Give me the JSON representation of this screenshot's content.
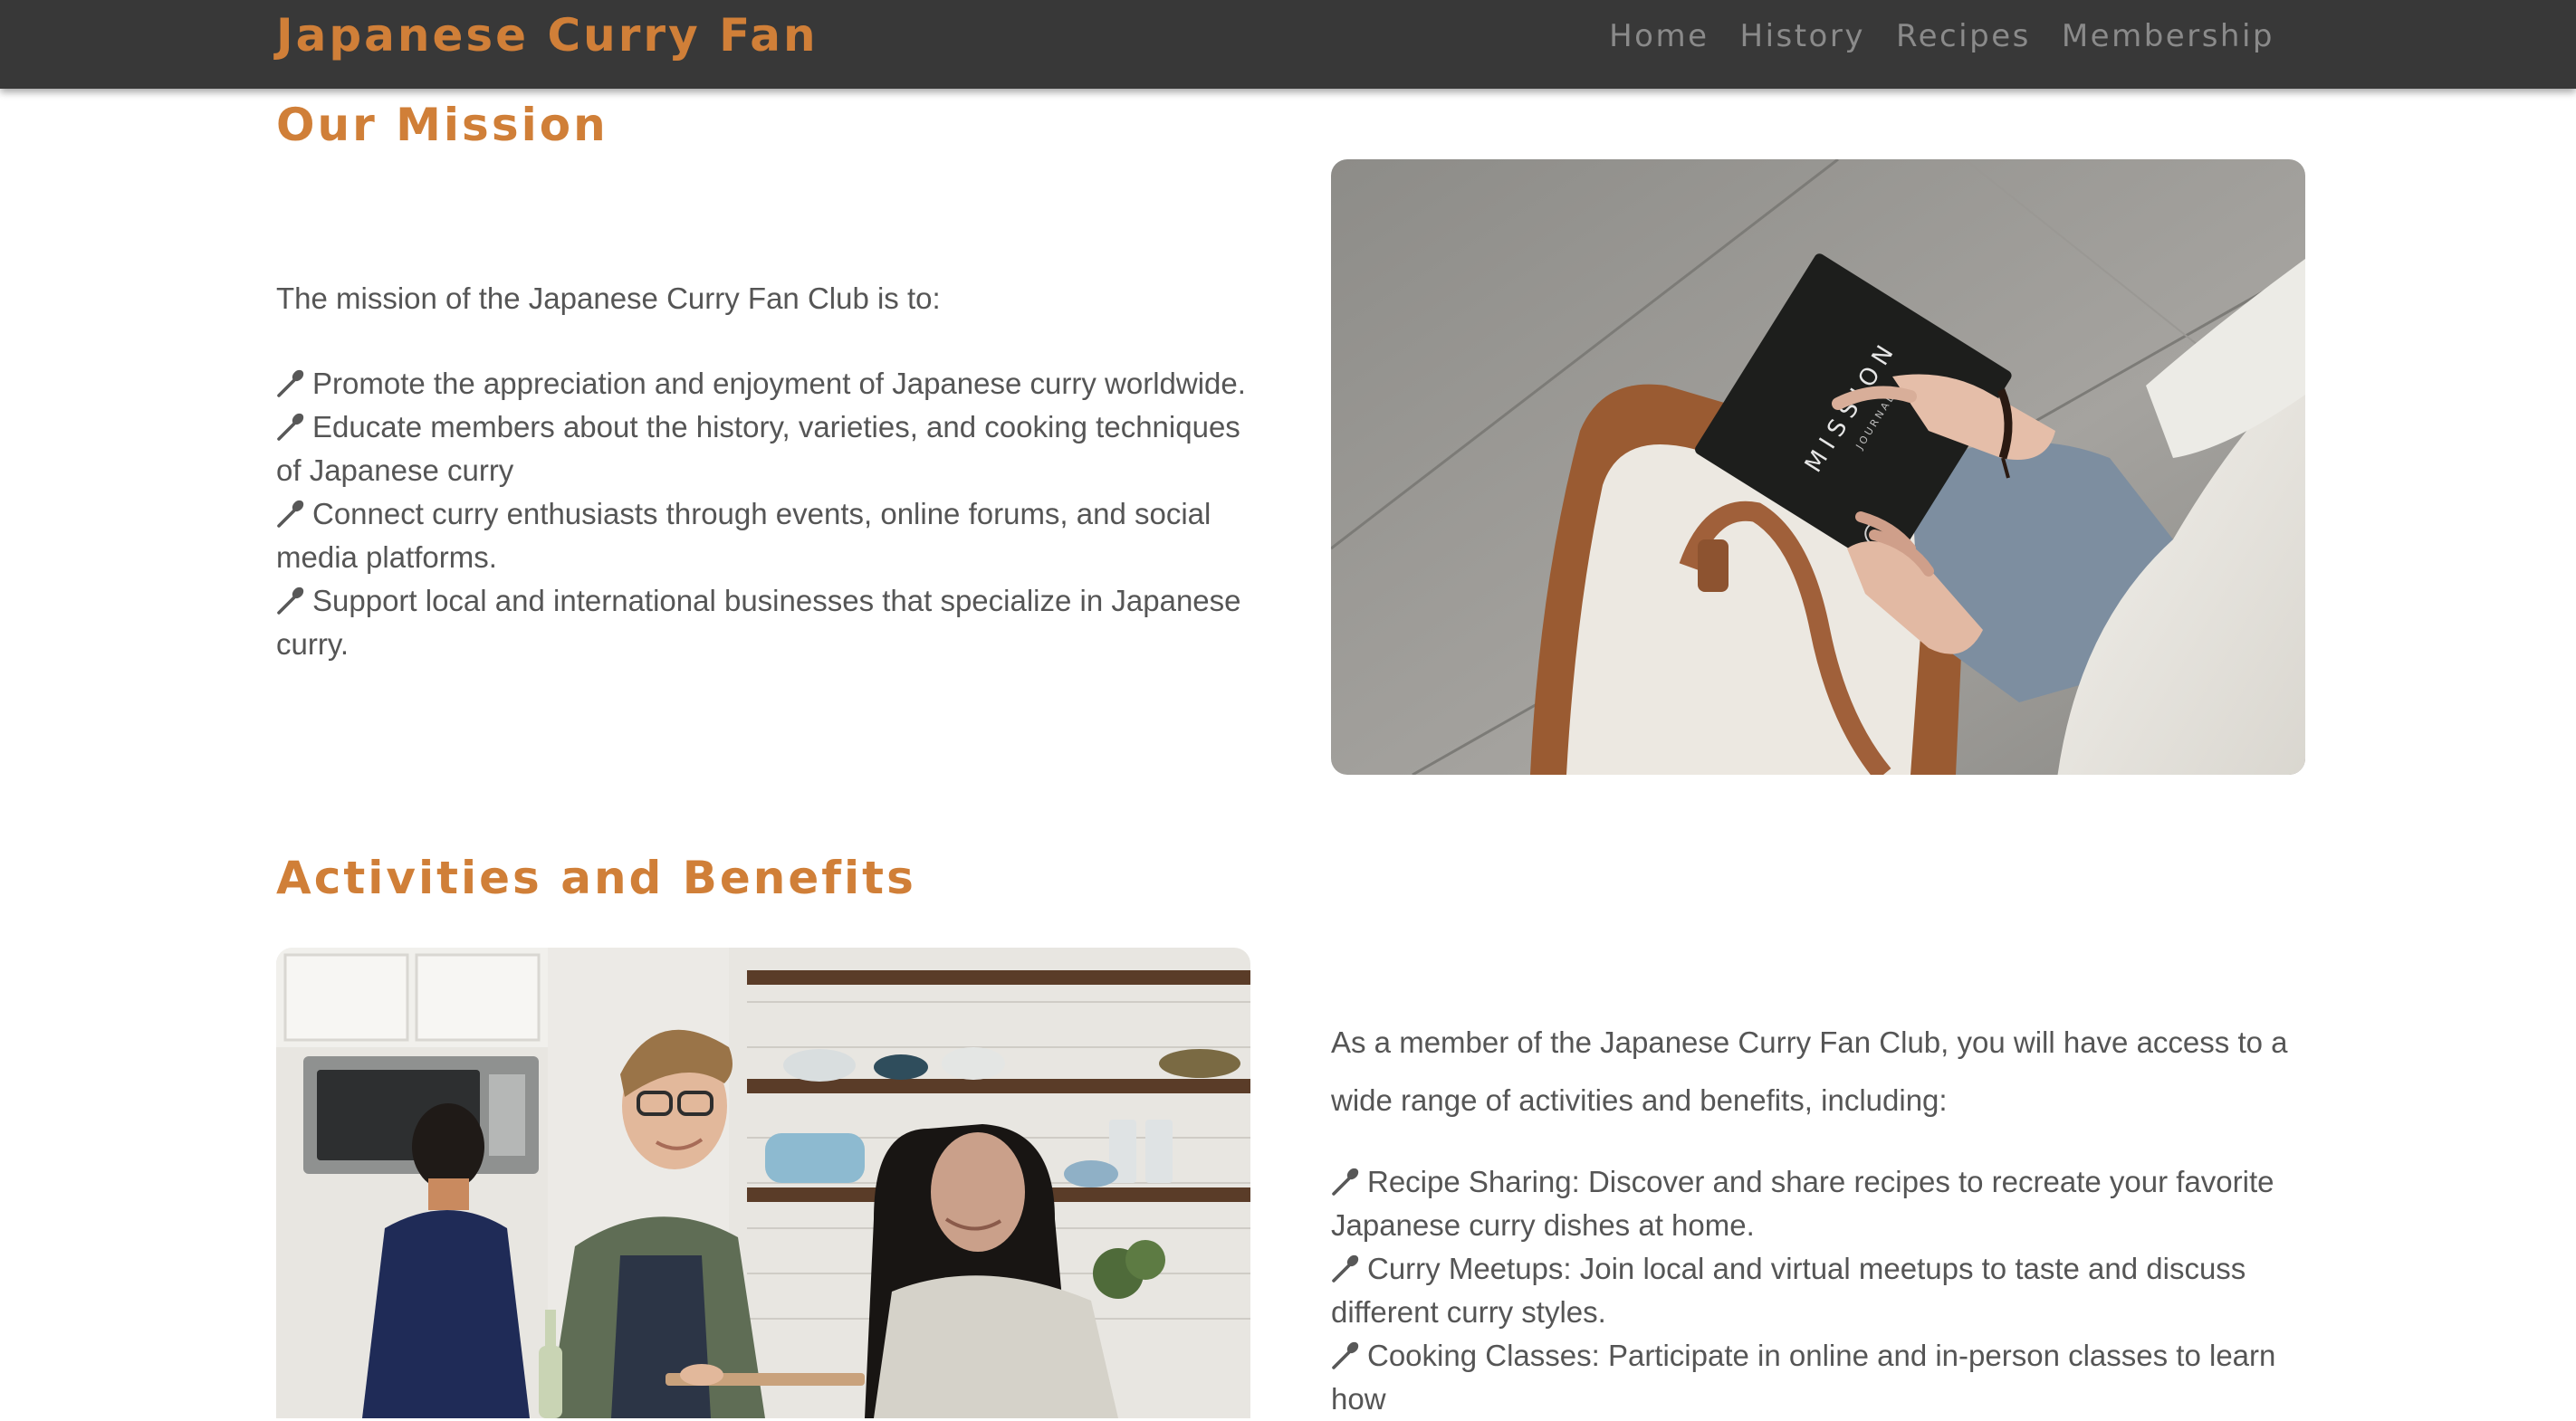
{
  "header": {
    "brand": "Japanese Curry Fan",
    "nav": [
      "Home",
      "History",
      "Recipes",
      "Membership"
    ]
  },
  "mission": {
    "title": "Our Mission",
    "intro": "The mission of the Japanese Curry Fan Club is to:",
    "items": [
      "Promote the appreciation and enjoyment of Japanese curry worldwide.",
      "Educate members about the history, varieties, and cooking techniques of Japanese curry",
      "Connect curry enthusiasts through events, online forums, and social media platforms.",
      "Support local and international businesses that specialize in Japanese curry."
    ],
    "image": {
      "book_title": "MISSION",
      "book_subtitle": "JOURNAL"
    }
  },
  "activities": {
    "title": "Activities and Benefits",
    "intro": "As a member of the Japanese Curry Fan Club, you will have access to a wide range of activities and benefits, including:",
    "items": [
      "Recipe Sharing: Discover and share recipes to recreate your favorite Japanese curry dishes at home.",
      "Curry Meetups: Join local and virtual meetups to taste and discuss different curry styles.",
      "Cooking Classes: Participate in online and in-person classes to learn how"
    ]
  },
  "icons": {
    "list_bullet": "spoon-icon"
  },
  "colors": {
    "accent": "#d07f38",
    "header_bg": "#383838",
    "nav_text": "#8a8a8a",
    "body_text": "#555555"
  }
}
